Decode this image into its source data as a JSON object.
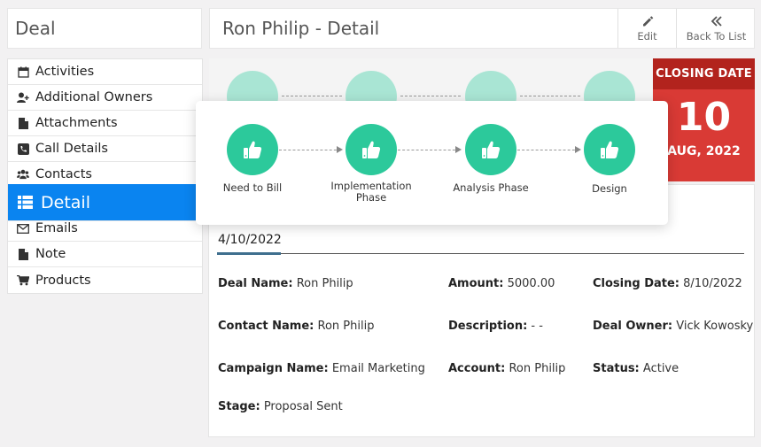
{
  "module_title": "Deal",
  "page_title": "Ron Philip - Detail",
  "toolbar": {
    "edit_label": "Edit",
    "back_label": "Back To List"
  },
  "sidebar": {
    "items": [
      {
        "label": "Activities",
        "icon": "calendar-icon"
      },
      {
        "label": "Additional Owners",
        "icon": "user-plus-icon"
      },
      {
        "label": "Attachments",
        "icon": "file-icon"
      },
      {
        "label": "Call Details",
        "icon": "phone-icon"
      },
      {
        "label": "Contacts",
        "icon": "users-icon"
      },
      {
        "label": "Detail",
        "icon": "list-icon",
        "active": true
      },
      {
        "label": "Emails",
        "icon": "envelope-icon"
      },
      {
        "label": "Note",
        "icon": "file-icon"
      },
      {
        "label": "Products",
        "icon": "cart-icon"
      }
    ]
  },
  "stages": [
    {
      "label": "Need to Bill"
    },
    {
      "label": "Implementation Phase"
    },
    {
      "label": "Analysis Phase"
    },
    {
      "label": "Design"
    }
  ],
  "closing": {
    "label": "CLOSING DATE",
    "day": "10",
    "month_year": "AUG, 2022"
  },
  "details": {
    "date": "4/10/2022",
    "deal_name": {
      "label": "Deal Name:",
      "value": "Ron Philip"
    },
    "amount": {
      "label": "Amount:",
      "value": "5000.00"
    },
    "closing_date": {
      "label": "Closing Date:",
      "value": "8/10/2022"
    },
    "contact_name": {
      "label": "Contact Name:",
      "value": "Ron Philip"
    },
    "description": {
      "label": "Description:",
      "value": "- -"
    },
    "deal_owner": {
      "label": "Deal Owner:",
      "value": "Vick Kowosky"
    },
    "campaign_name": {
      "label": "Campaign Name:",
      "value": "Email Marketing"
    },
    "account": {
      "label": "Account:",
      "value": "Ron Philip"
    },
    "status": {
      "label": "Status:",
      "value": "Active"
    },
    "stage": {
      "label": "Stage:",
      "value": "Proposal Sent"
    }
  },
  "colors": {
    "accent": "#0a84f0",
    "stage_green": "#2cc99b",
    "closing_red": "#d93a35"
  }
}
